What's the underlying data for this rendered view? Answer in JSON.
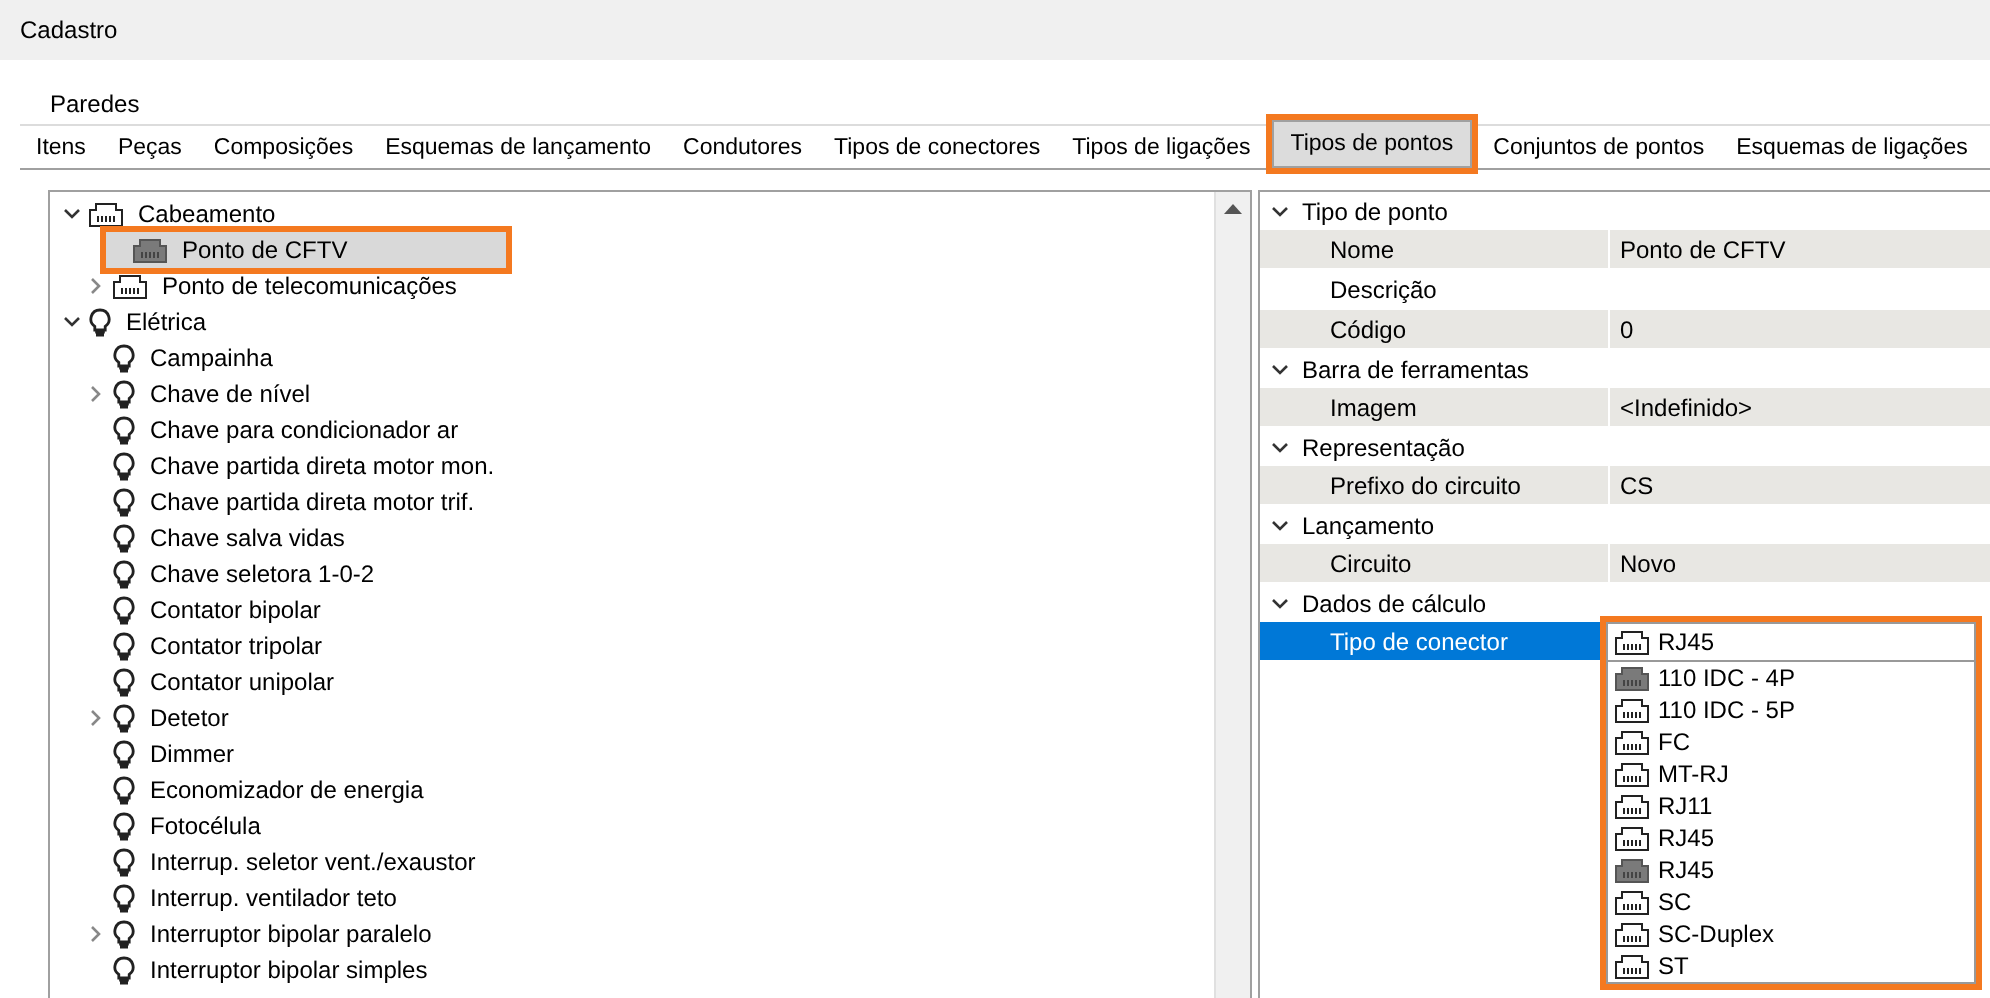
{
  "window": {
    "title": "Cadastro"
  },
  "group_label": "Paredes",
  "tabs": [
    {
      "label": "Itens",
      "selected": false
    },
    {
      "label": "Peças",
      "selected": false
    },
    {
      "label": "Composições",
      "selected": false
    },
    {
      "label": "Esquemas de lançamento",
      "selected": false
    },
    {
      "label": "Condutores",
      "selected": false
    },
    {
      "label": "Tipos de conectores",
      "selected": false
    },
    {
      "label": "Tipos de ligações",
      "selected": false
    },
    {
      "label": "Tipos de pontos",
      "selected": true
    },
    {
      "label": "Conjuntos de pontos",
      "selected": false
    },
    {
      "label": "Esquemas de ligações",
      "selected": false
    }
  ],
  "tree": [
    {
      "label": "Cabeamento",
      "kind": "connector-outline",
      "expanded": true,
      "selected": false,
      "children": [
        {
          "label": "Ponto de CFTV",
          "kind": "connector-filled",
          "selected": true
        },
        {
          "label": "Ponto de telecomunicações",
          "kind": "connector-outline",
          "expanded": false,
          "selected": false
        }
      ]
    },
    {
      "label": "Elétrica",
      "kind": "bulb",
      "expanded": true,
      "selected": false,
      "children": [
        {
          "label": "Campainha",
          "kind": "bulb",
          "selected": false
        },
        {
          "label": "Chave de nível",
          "kind": "bulb",
          "expanded": false,
          "selected": false
        },
        {
          "label": "Chave para condicionador ar",
          "kind": "bulb",
          "selected": false
        },
        {
          "label": "Chave partida direta motor mon.",
          "kind": "bulb",
          "selected": false
        },
        {
          "label": "Chave partida direta motor trif.",
          "kind": "bulb",
          "selected": false
        },
        {
          "label": "Chave salva vidas",
          "kind": "bulb",
          "selected": false
        },
        {
          "label": "Chave seletora 1-0-2",
          "kind": "bulb",
          "selected": false
        },
        {
          "label": "Contator bipolar",
          "kind": "bulb",
          "selected": false
        },
        {
          "label": "Contator tripolar",
          "kind": "bulb",
          "selected": false
        },
        {
          "label": "Contator unipolar",
          "kind": "bulb",
          "selected": false
        },
        {
          "label": "Detetor",
          "kind": "bulb",
          "expanded": false,
          "selected": false
        },
        {
          "label": "Dimmer",
          "kind": "bulb",
          "selected": false
        },
        {
          "label": "Economizador de energia",
          "kind": "bulb",
          "selected": false
        },
        {
          "label": "Fotocélula",
          "kind": "bulb",
          "selected": false
        },
        {
          "label": "Interrup. seletor vent./exaustor",
          "kind": "bulb",
          "selected": false
        },
        {
          "label": "Interrup. ventilador teto",
          "kind": "bulb",
          "selected": false
        },
        {
          "label": "Interruptor bipolar paralelo",
          "kind": "bulb",
          "expanded": false,
          "selected": false
        },
        {
          "label": "Interruptor bipolar simples",
          "kind": "bulb",
          "selected": false
        }
      ]
    }
  ],
  "properties": [
    {
      "section": "Tipo de ponto",
      "expanded": true,
      "rows": [
        {
          "label": "Nome",
          "value": "Ponto de CFTV",
          "readonly": true,
          "selected": false
        },
        {
          "label": "Descrição",
          "readonly": false,
          "selected": false
        },
        {
          "label": "Código",
          "value": "0",
          "readonly": true,
          "selected": false
        }
      ]
    },
    {
      "section": "Barra de ferramentas",
      "expanded": true,
      "rows": [
        {
          "label": "Imagem",
          "value": "<Indefinido>",
          "readonly": true,
          "selected": false
        }
      ]
    },
    {
      "section": "Representação",
      "expanded": true,
      "rows": [
        {
          "label": "Prefixo do circuito",
          "value": "CS",
          "readonly": true,
          "selected": false
        }
      ]
    },
    {
      "section": "Lançamento",
      "expanded": true,
      "rows": [
        {
          "label": "Circuito",
          "value": "Novo",
          "readonly": true,
          "selected": false
        }
      ]
    },
    {
      "section": "Dados de cálculo",
      "expanded": true,
      "rows": [
        {
          "label": "Tipo de conector",
          "readonly": false,
          "selected": true,
          "dropdown": {
            "value": "RJ45",
            "kind": "connector-outline",
            "highlighted": true,
            "options": [
              {
                "label": "110 IDC - 4P",
                "kind": "connector-filled"
              },
              {
                "label": "110 IDC - 5P",
                "kind": "connector-outline"
              },
              {
                "label": "FC",
                "kind": "connector-outline"
              },
              {
                "label": "MT-RJ",
                "kind": "connector-outline"
              },
              {
                "label": "RJ11",
                "kind": "connector-outline"
              },
              {
                "label": "RJ45",
                "kind": "connector-outline"
              },
              {
                "label": "RJ45",
                "kind": "connector-filled"
              },
              {
                "label": "SC",
                "kind": "connector-outline"
              },
              {
                "label": "SC-Duplex",
                "kind": "connector-outline"
              },
              {
                "label": "ST",
                "kind": "connector-outline"
              }
            ]
          }
        }
      ]
    }
  ]
}
